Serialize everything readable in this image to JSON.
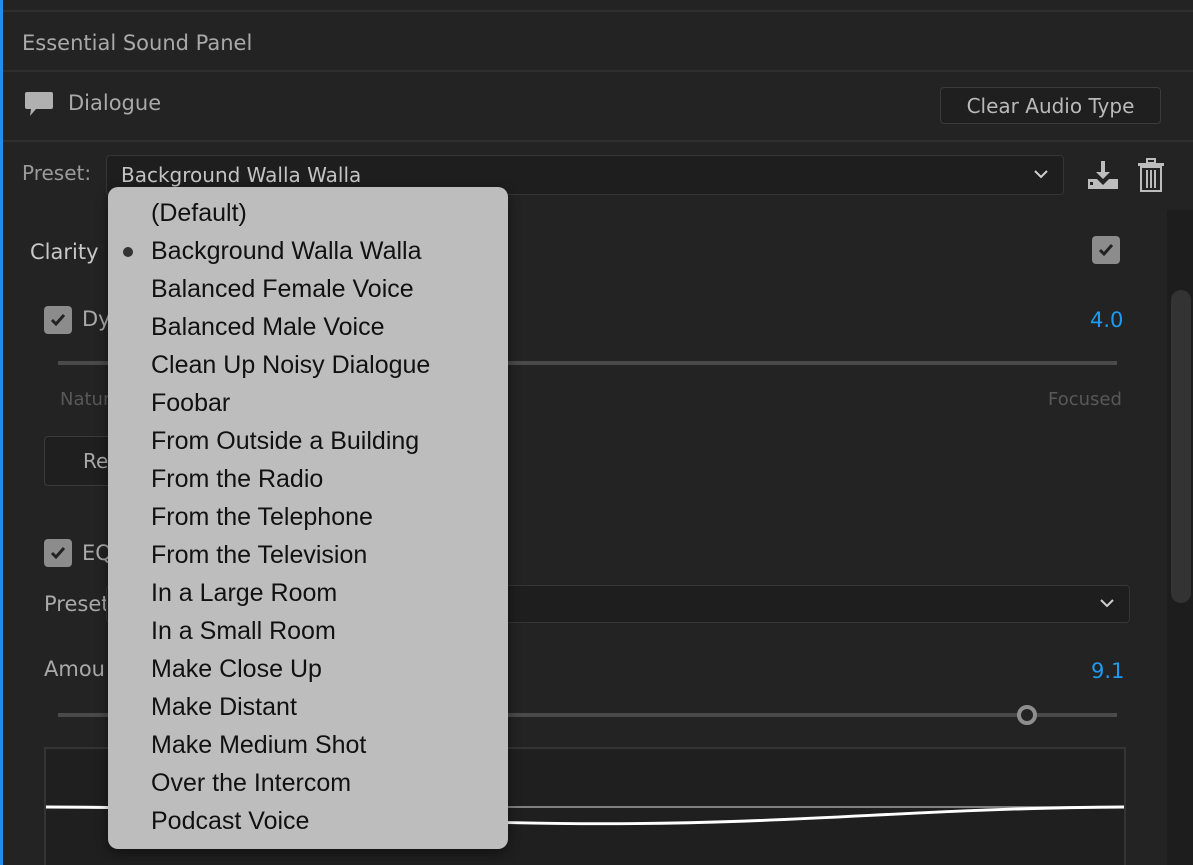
{
  "panel": {
    "title": "Essential Sound Panel",
    "audio_type": "Dialogue",
    "audio_type_icon": "speech-bubble-icon",
    "clear_button": "Clear Audio Type",
    "preset_label": "Preset:",
    "preset_value": "Background Walla Walla",
    "save_icon": "save-preset-icon",
    "delete_icon": "trash-icon"
  },
  "clarity": {
    "heading": "Clarity",
    "enabled": true,
    "dynamics": {
      "label_visible": "Dy",
      "checked": true,
      "value": "4.0",
      "left_label_visible": "Natur",
      "right_label": "Focused"
    },
    "reset_button_visible": "Re",
    "eq": {
      "label_visible": "EQ",
      "checked": true,
      "preset_label_visible": "Preset",
      "amount_label_visible": "Amou",
      "amount_value": "9.1",
      "amount_fraction": 0.91
    }
  },
  "accent_color": "#1e9bef",
  "dropdown": {
    "selected_index": 1,
    "items": [
      "(Default)",
      "Background Walla Walla",
      "Balanced Female Voice",
      "Balanced Male Voice",
      "Clean Up Noisy Dialogue",
      "Foobar",
      "From Outside a Building",
      "From the Radio",
      "From the Telephone",
      "From the Television",
      "In a Large Room",
      "In a Small Room",
      "Make Close Up",
      "Make Distant",
      "Make Medium Shot",
      "Over the Intercom",
      "Podcast Voice"
    ]
  }
}
